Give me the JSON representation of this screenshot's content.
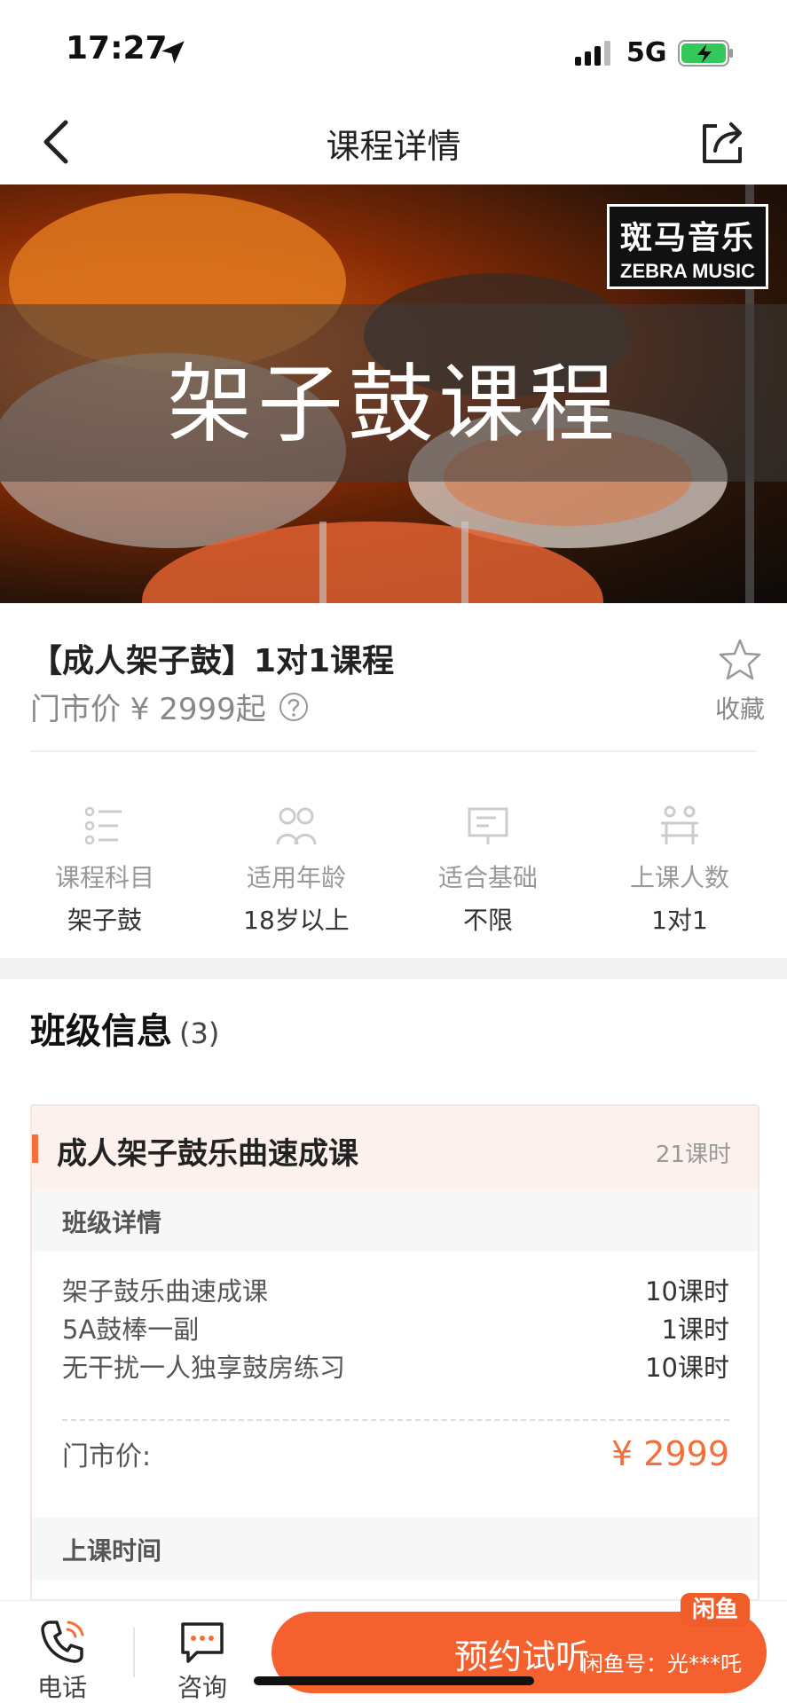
{
  "status_bar": {
    "time": "17:27",
    "network": "5G",
    "icons": [
      "location-arrow-icon",
      "signal-icon",
      "battery-charging-icon"
    ]
  },
  "nav": {
    "title": "课程详情",
    "back_icon": "chevron-left-icon",
    "share_icon": "share-icon"
  },
  "banner": {
    "title": "架子鼓课程",
    "logo_cn": "斑马音乐",
    "logo_en": "ZEBRA MUSIC"
  },
  "course": {
    "title": "【成人架子鼓】1对1课程",
    "price": "门市价 ¥ 2999起",
    "favorite_label": "收藏"
  },
  "attributes": [
    {
      "icon": "list-icon",
      "label": "课程科目",
      "value": "架子鼓"
    },
    {
      "icon": "people-icon",
      "label": "适用年龄",
      "value": "18岁以上"
    },
    {
      "icon": "whiteboard-icon",
      "label": "适合基础",
      "value": "不限"
    },
    {
      "icon": "class-size-icon",
      "label": "上课人数",
      "value": "1对1"
    }
  ],
  "section": {
    "title": "班级信息",
    "count": "(3)"
  },
  "class_card": {
    "title": "成人架子鼓乐曲速成课",
    "hours": "21课时",
    "detail_heading": "班级详情",
    "items": [
      {
        "name": "架子鼓乐曲速成课",
        "hours": "10课时"
      },
      {
        "name": "5A鼓棒一副",
        "hours": "1课时"
      },
      {
        "name": "无干扰一人独享鼓房练习",
        "hours": "10课时"
      }
    ],
    "price_label": "门市价:",
    "price_value": "¥ 2999",
    "schedule_heading": "上课时间"
  },
  "bottom_bar": {
    "phone_label": "电话",
    "consult_label": "咨询",
    "book_label": "预约试听"
  },
  "watermark": {
    "badge": "闲鱼",
    "text": "闲鱼号：光***吒"
  },
  "colors": {
    "accent": "#f46f3b",
    "button": "#f4612f"
  }
}
